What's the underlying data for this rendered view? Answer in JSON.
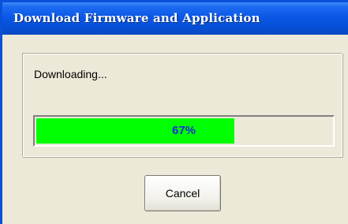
{
  "window": {
    "title": "Download Firmware and Application"
  },
  "status": {
    "label": "Downloading...",
    "progress_fraction": 0.67,
    "progress_text": "67%"
  },
  "actions": {
    "cancel_label": "Cancel"
  },
  "colors": {
    "titlebar": "#0a58e5",
    "window_bg": "#ece9d8",
    "progress_fill": "#00ff00",
    "progress_text": "#1a2ad6"
  }
}
